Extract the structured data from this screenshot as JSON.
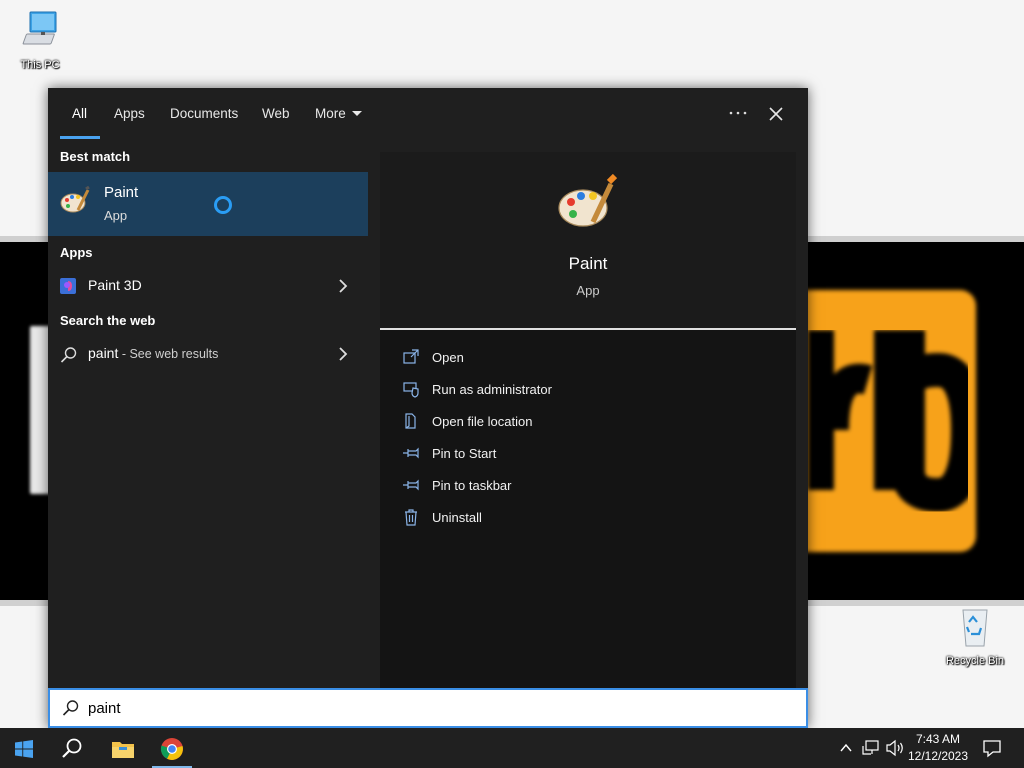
{
  "desktop": {
    "icons": [
      {
        "label": "This PC"
      },
      {
        "label": "Recycle Bin"
      }
    ]
  },
  "search_panel": {
    "tabs": [
      {
        "label": "All",
        "active": true
      },
      {
        "label": "Apps"
      },
      {
        "label": "Documents"
      },
      {
        "label": "Web"
      },
      {
        "label": "More"
      }
    ],
    "more_options_icon": "ellipsis-icon",
    "close_icon": "close-icon",
    "best_match": {
      "section_label": "Best match",
      "title": "Paint",
      "subtitle": "App"
    },
    "apps": {
      "section_label": "Apps",
      "items": [
        {
          "title": "Paint 3D"
        }
      ]
    },
    "web": {
      "section_label": "Search the web",
      "query": "paint",
      "suffix": " - See web results"
    },
    "detail": {
      "name": "Paint",
      "type": "App",
      "actions": [
        {
          "label": "Open",
          "icon": "open-icon"
        },
        {
          "label": "Run as administrator",
          "icon": "shield-icon"
        },
        {
          "label": "Open file location",
          "icon": "file-location-icon"
        },
        {
          "label": "Pin to Start",
          "icon": "pin-icon"
        },
        {
          "label": "Pin to taskbar",
          "icon": "pin-icon"
        },
        {
          "label": "Uninstall",
          "icon": "trash-icon"
        }
      ]
    },
    "search_box": {
      "value": "paint"
    }
  },
  "taskbar": {
    "time": "7:43 AM",
    "date": "12/12/2023"
  },
  "colors": {
    "accent": "#4aa3f0",
    "selected_row": "#1c3f5c",
    "panel_bg": "#1f1f1f",
    "wallpaper_logo": "#f7a21a"
  }
}
